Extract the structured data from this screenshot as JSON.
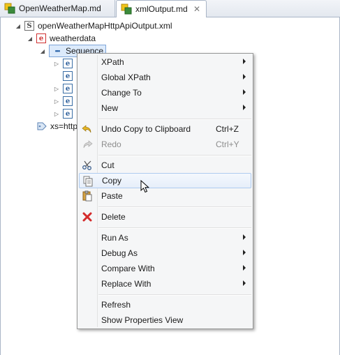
{
  "tabs": [
    {
      "label": "OpenWeatherMap.md",
      "active": false
    },
    {
      "label": "xmlOutput.md",
      "active": true,
      "close_glyph": "✕"
    }
  ],
  "tree": {
    "root_label": "openWeatherMapHttpApiOutput.xml",
    "root_icon": "S",
    "weatherdata_label": "weatherdata",
    "element_icon": "e",
    "sequence_label": "Sequence",
    "child_rows": 4,
    "xs_label": "xs=http"
  },
  "menu": {
    "items": [
      {
        "label": "XPath",
        "submenu": true
      },
      {
        "label": "Global XPath",
        "submenu": true
      },
      {
        "label": "Change To",
        "submenu": true
      },
      {
        "label": "New",
        "submenu": true
      },
      {
        "label": "Undo Copy to Clipboard",
        "accel": "Ctrl+Z",
        "icon": "undo-icon"
      },
      {
        "label": "Redo",
        "accel": "Ctrl+Y",
        "icon": "redo-icon",
        "disabled": true
      },
      {
        "label": "Cut",
        "icon": "scissors-icon"
      },
      {
        "label": "Copy",
        "icon": "copy-icon",
        "highlighted": true
      },
      {
        "label": "Paste",
        "icon": "paste-icon"
      },
      {
        "label": "Delete",
        "icon": "delete-icon"
      },
      {
        "label": "Run As",
        "submenu": true
      },
      {
        "label": "Debug As",
        "submenu": true
      },
      {
        "label": "Compare With",
        "submenu": true
      },
      {
        "label": "Replace With",
        "submenu": true
      },
      {
        "label": "Refresh"
      },
      {
        "label": "Show Properties View"
      }
    ]
  },
  "colors": {
    "delete_red": "#d42b2b",
    "undo_yellow": "#e8b725",
    "highlight_border": "#aecbf0"
  }
}
